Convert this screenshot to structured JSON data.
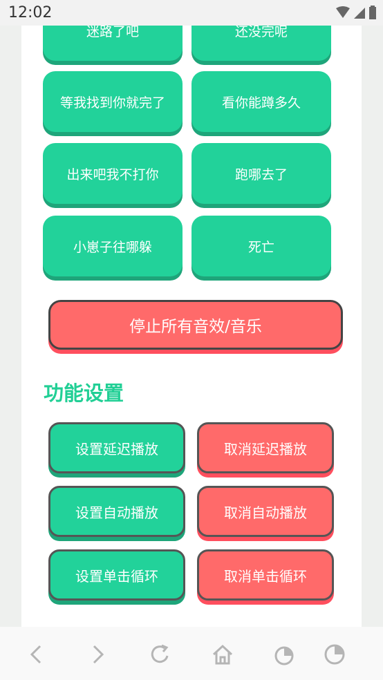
{
  "status": {
    "time": "12:02"
  },
  "sound_buttons": [
    {
      "label": "迷路了吧"
    },
    {
      "label": "还没完呢"
    },
    {
      "label": "等我找到你就完了"
    },
    {
      "label": "看你能蹲多久"
    },
    {
      "label": "出来吧我不打你"
    },
    {
      "label": "跑哪去了"
    },
    {
      "label": "小崽子往哪躲"
    },
    {
      "label": "死亡"
    }
  ],
  "stop_button": {
    "label": "停止所有音效/音乐"
  },
  "settings": {
    "title": "功能设置",
    "buttons": [
      {
        "label": "设置延迟播放"
      },
      {
        "label": "取消延迟播放"
      },
      {
        "label": "设置自动播放"
      },
      {
        "label": "取消自动播放"
      },
      {
        "label": "设置单击循环"
      },
      {
        "label": "取消单击循环"
      }
    ]
  },
  "colors": {
    "green": "#22d29a",
    "red": "#ff6a6a",
    "title_green": "#21cf95"
  },
  "nav_icons": [
    "back-icon",
    "forward-icon",
    "refresh-icon",
    "home-icon",
    "tabs-icon",
    "menu-icon"
  ]
}
